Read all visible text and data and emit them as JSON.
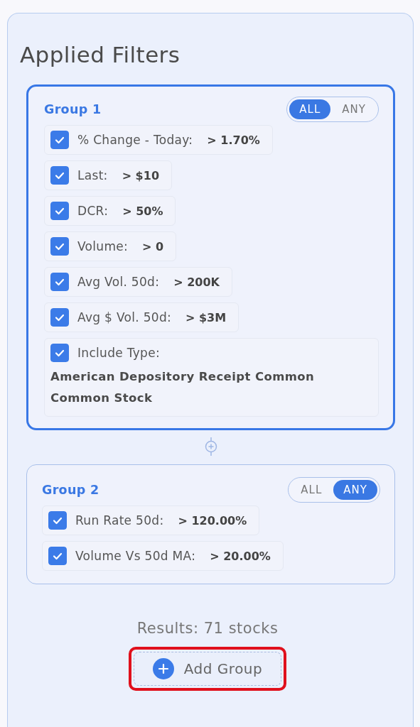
{
  "panel": {
    "title": "Applied Filters"
  },
  "groups": [
    {
      "name": "Group 1",
      "active": true,
      "match": [
        {
          "label": "ALL",
          "selected": true
        },
        {
          "label": "ANY",
          "selected": false
        }
      ],
      "filters": [
        {
          "kind": "condition",
          "label": "% Change - Today:",
          "value": "> 1.70%",
          "checked": true
        },
        {
          "kind": "condition",
          "label": "Last:",
          "value": "> $10",
          "checked": true
        },
        {
          "kind": "condition",
          "label": "DCR:",
          "value": "> 50%",
          "checked": true
        },
        {
          "kind": "condition",
          "label": "Volume:",
          "value": "> 0",
          "checked": true
        },
        {
          "kind": "condition",
          "label": "Avg Vol. 50d:",
          "value": "> 200K",
          "checked": true
        },
        {
          "kind": "condition",
          "label": "Avg $ Vol. 50d:",
          "value": "> $3M",
          "checked": true
        },
        {
          "kind": "list",
          "label": "Include Type:",
          "items": [
            "American Depository Receipt Common",
            "Common Stock"
          ],
          "checked": true
        }
      ]
    },
    {
      "name": "Group 2",
      "active": false,
      "match": [
        {
          "label": "ALL",
          "selected": false
        },
        {
          "label": "ANY",
          "selected": true
        }
      ],
      "filters": [
        {
          "kind": "condition",
          "label": "Run Rate 50d:",
          "value": "> 120.00%",
          "checked": true
        },
        {
          "kind": "condition",
          "label": "Volume Vs 50d MA:",
          "value": "> 20.00%",
          "checked": true
        }
      ]
    }
  ],
  "results": "Results: 71 stocks",
  "add_group": {
    "label": "Add Group",
    "highlighted": true
  }
}
